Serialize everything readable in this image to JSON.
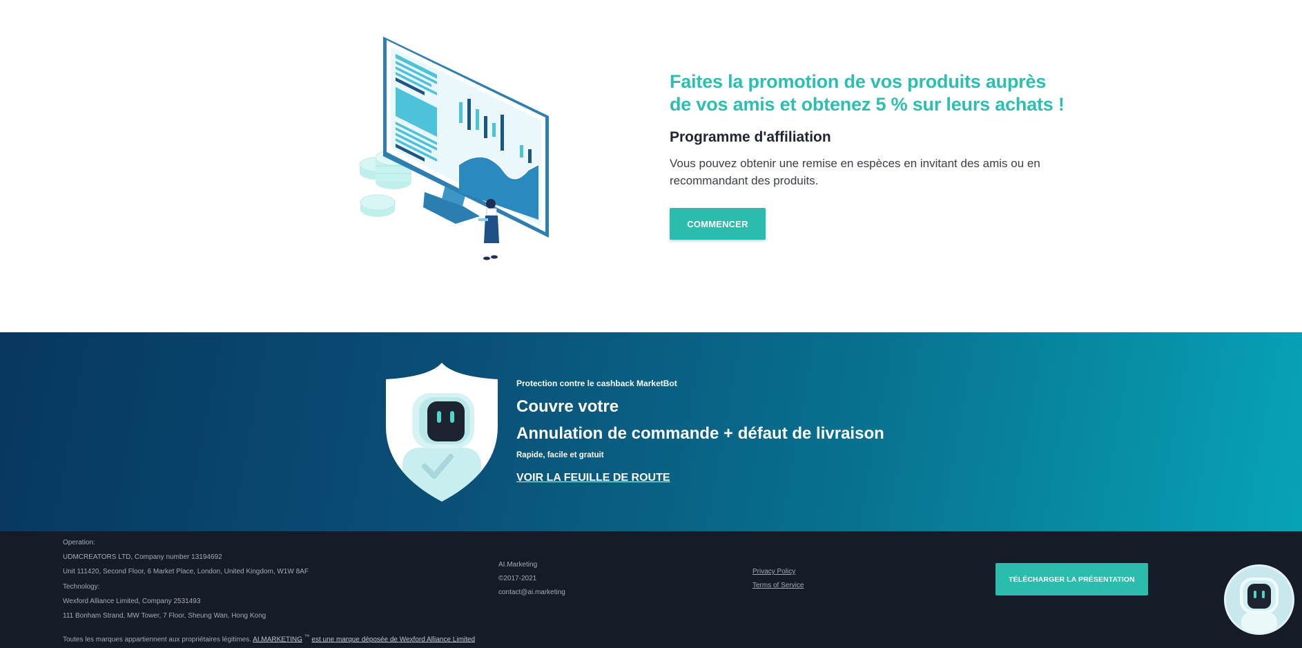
{
  "affiliate": {
    "headline_line1": "Faites la promotion de vos produits auprès",
    "headline_line2": "de vos amis et obtenez 5 % sur leurs achats !",
    "subtitle": "Programme d'affiliation",
    "description": "Vous pouvez obtenir une remise en espèces en invitant des amis ou en recommandant des produits.",
    "button_label": "COMMENCER"
  },
  "protection": {
    "kicker": "Protection contre le cashback MarketBot",
    "title_line1": "Couvre votre",
    "title_line2": "Annulation de commande + défaut de livraison",
    "note": "Rapide, facile et gratuit",
    "link_label": "VOIR LA FEUILLE DE ROUTE"
  },
  "footer": {
    "operation_label": "Operation:",
    "operation_company": "UDMCREATORS LTD, Company number 13194692",
    "operation_address": "Unit 111420, Second Floor, 6 Market Place, London, United Kingdom, W1W 8AF",
    "technology_label": "Technology:",
    "technology_company": "Wexford Alliance Limited, Company 2531493",
    "technology_address": "111 Bonham Strand, MW Tower, 7 Floor, Sheung Wan, Hong Kong",
    "brand_name": "AI.Marketing",
    "copyright": "©2017-2021",
    "email": "contact@ai.marketing",
    "privacy_link": "Privacy Policy",
    "terms_link": "Terms of Service",
    "download_button": "TÉLÉCHARGER LA PRÉSENTATION",
    "legal_prefix": "Toutes les marques appartiennent aux propriétaires légitimes.",
    "legal_brand_link": "AI.MARKETING",
    "legal_tm": "™",
    "legal_registered_link": "est une marque déposée de Wexford Alliance Limited"
  },
  "colors": {
    "accent": "#2cbcad",
    "headline": "#2bbfb1",
    "banner_start": "#07375f",
    "banner_end": "#07a3b7",
    "footer_bg": "#151b27"
  },
  "icons": {
    "chatbot": "robot-icon",
    "shield": "shield-icon"
  }
}
